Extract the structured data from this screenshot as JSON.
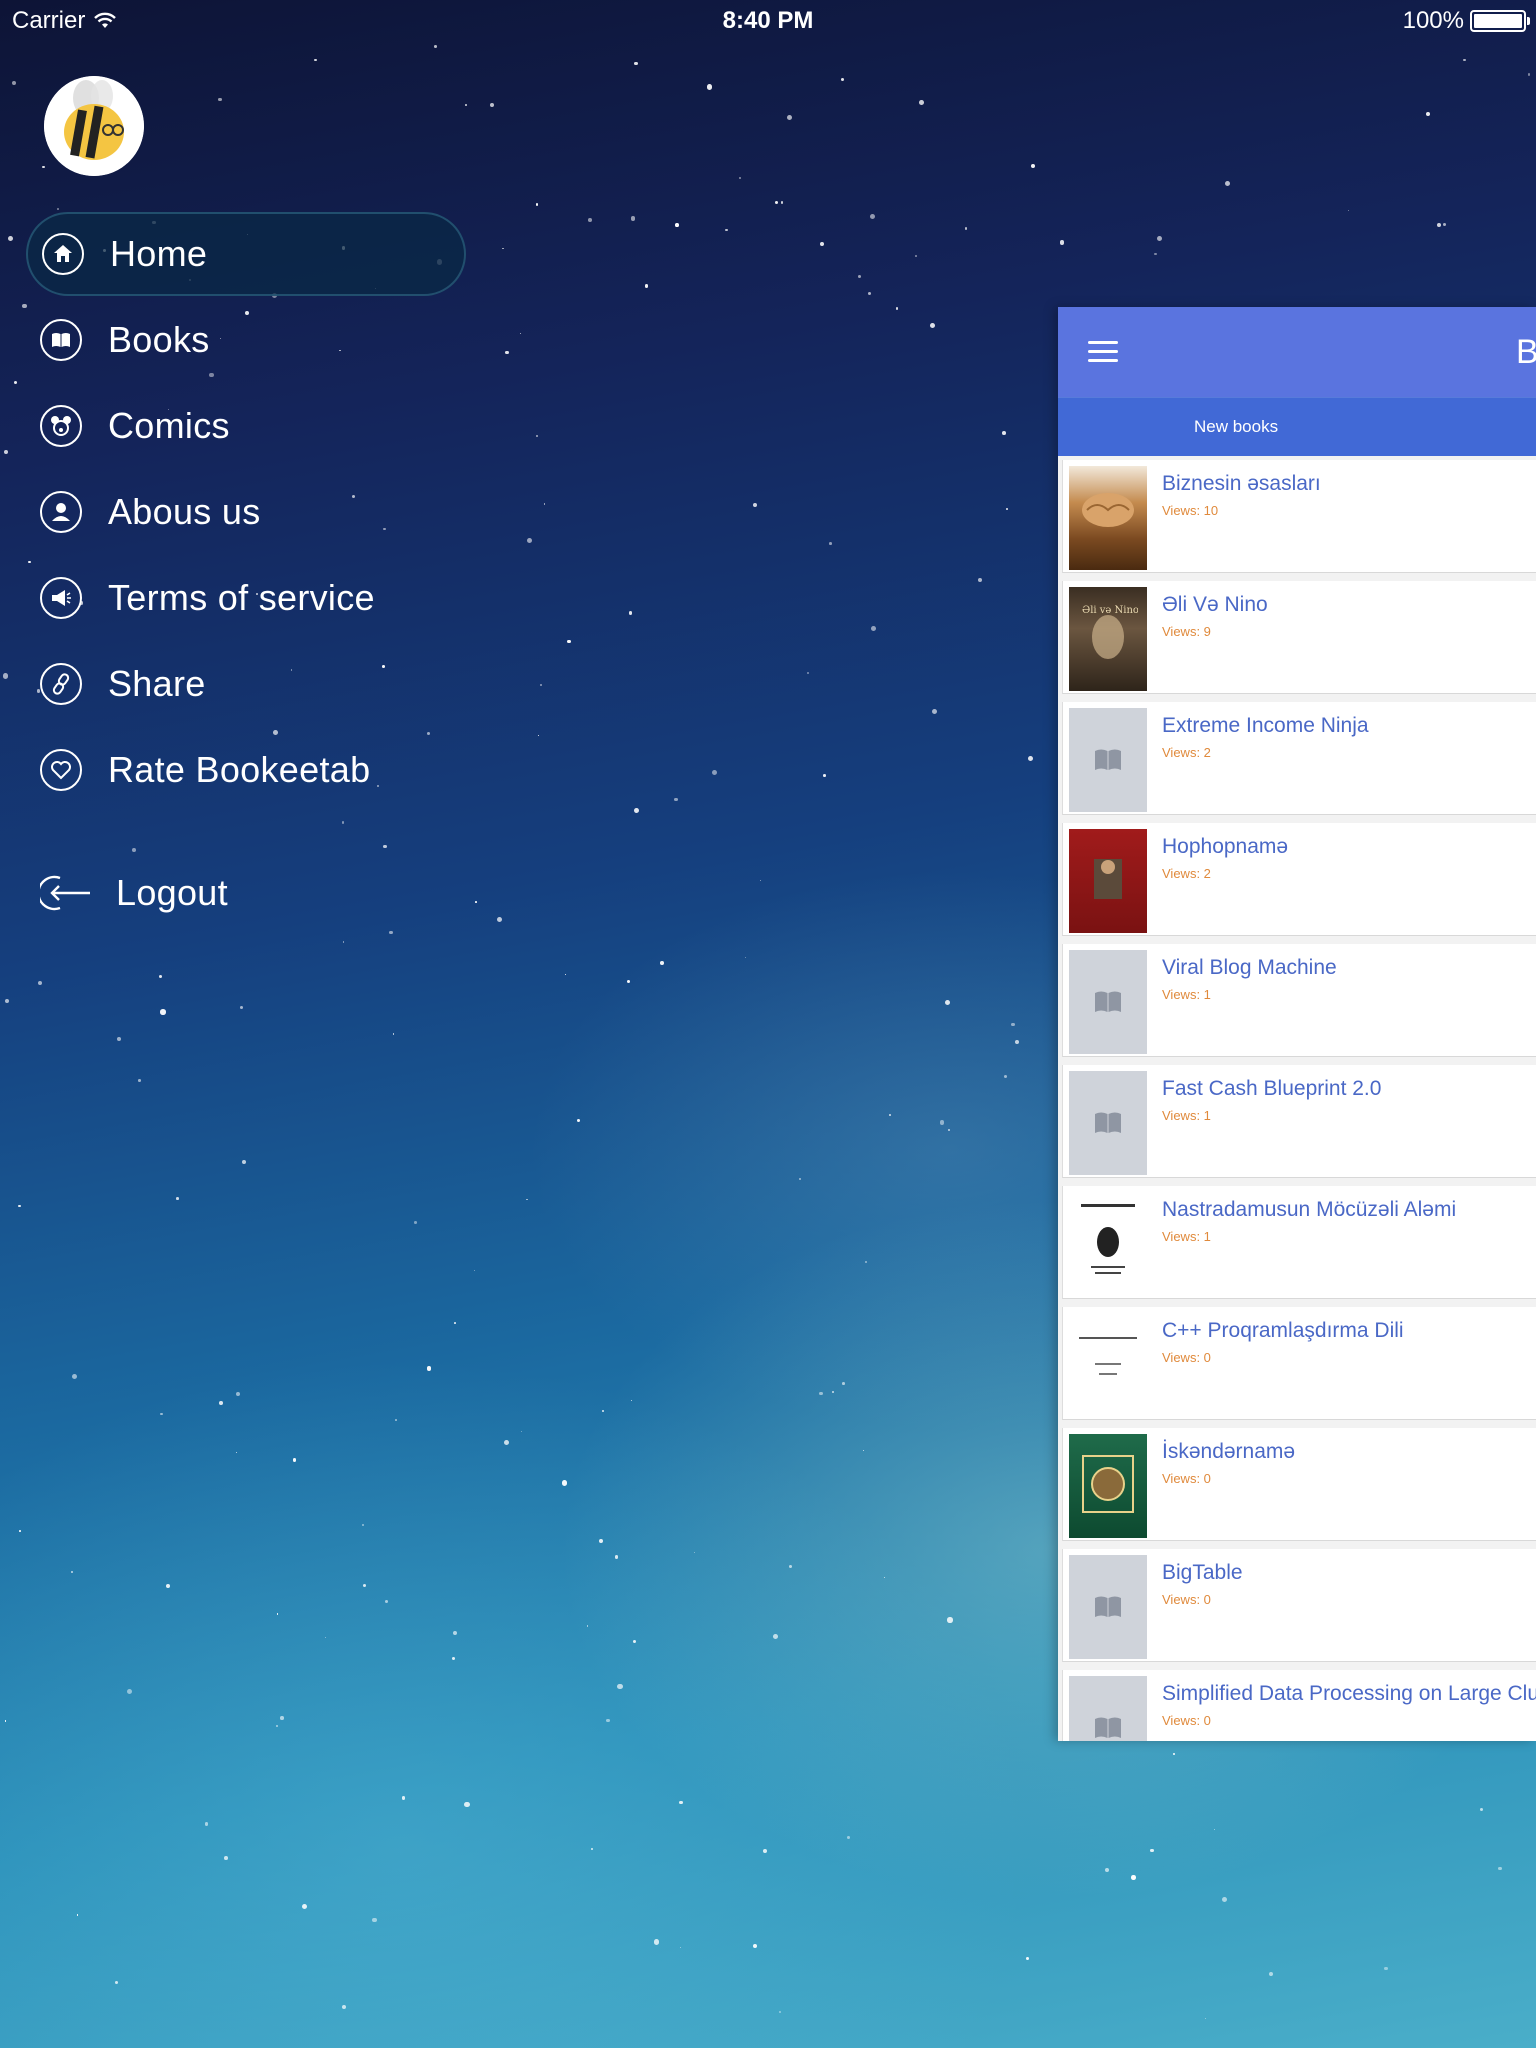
{
  "status_bar": {
    "carrier": "Carrier",
    "time": "8:40 PM",
    "battery": "100%",
    "battery_level": 1.0
  },
  "menu": {
    "items": [
      {
        "label": "Home",
        "icon": "home-icon"
      },
      {
        "label": "Books",
        "icon": "book-icon"
      },
      {
        "label": "Comics",
        "icon": "mouse-icon"
      },
      {
        "label": "Abous us",
        "icon": "person-icon"
      },
      {
        "label": "Terms of service",
        "icon": "megaphone-icon"
      },
      {
        "label": "Share",
        "icon": "link-icon"
      },
      {
        "label": "Rate Bookeetab",
        "icon": "heart-icon"
      }
    ],
    "active": "Home",
    "logout_label": "Logout"
  },
  "main": {
    "title": "B",
    "tab_label": "New books",
    "books": [
      {
        "title": "Biznesin əsasları",
        "views": "Views: 10"
      },
      {
        "title": " Əli Və Nino",
        "views": "Views: 9"
      },
      {
        "title": "Extreme Income Ninja",
        "views": "Views: 2"
      },
      {
        "title": "Hophopnamə",
        "views": "Views: 2"
      },
      {
        "title": "Viral Blog Machine",
        "views": "Views: 1"
      },
      {
        "title": "Fast Cash Blueprint 2.0",
        "views": "Views: 1"
      },
      {
        "title": "Nastradamusun Möcüzəli Aləmi",
        "views": "Views: 1"
      },
      {
        "title": "C++ Proqramlaşdırma Dili",
        "views": "Views: 0"
      },
      {
        "title": "İskəndərnamə",
        "views": "Views: 0"
      },
      {
        "title": "BigTable",
        "views": "Views: 0"
      },
      {
        "title": "Simplified Data Processing on Large Clu",
        "views": "Views: 0"
      }
    ]
  },
  "colors": {
    "app_bar": "#5a74df",
    "tab_bar": "#4169d6",
    "book_title": "#4a68c6",
    "book_views": "#e08a3c"
  }
}
